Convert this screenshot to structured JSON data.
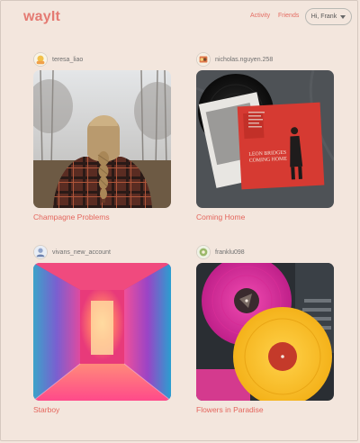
{
  "header": {
    "logo": "wayIt",
    "nav": {
      "activity": "Activity",
      "friends": "Friends"
    },
    "user_menu": "Hi, Frank"
  },
  "posts": [
    {
      "username": "teresa_liao",
      "title": "Champagne Problems",
      "art": "braided-hair-plaid-coat-forest"
    },
    {
      "username": "nicholas.nguyen.258",
      "title": "Coming Home",
      "art": "vinyl-record-leon-bridges-sleeve"
    },
    {
      "username": "vivans_new_account",
      "title": "Starboy",
      "art": "neon-pink-corridor"
    },
    {
      "username": "franklu098",
      "title": "Flowers in Paradise",
      "art": "pink-and-yellow-vinyl-records"
    }
  ],
  "album_text": {
    "coming_home_sleeve": "LEON BRIDGES\nCOMING HOME"
  },
  "colors": {
    "background": "#f3e6dd",
    "accent": "#e4665d",
    "logo": "#e47a72"
  }
}
